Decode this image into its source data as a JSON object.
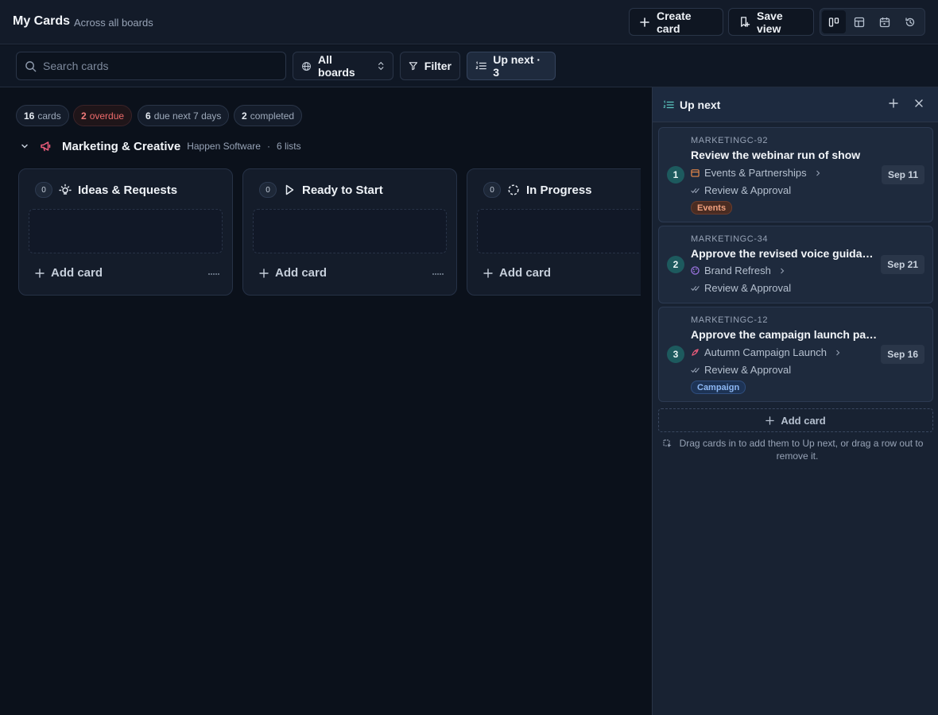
{
  "header": {
    "title": "My Cards",
    "subtitle": "Across all boards",
    "create_label": "Create card",
    "save_label": "Save view",
    "views": [
      "board-view-icon",
      "table-view-icon",
      "calendar-view-icon",
      "history-view-icon"
    ]
  },
  "toolbar": {
    "search_placeholder": "Search cards",
    "boards_label": "All boards",
    "filter_label": "Filter",
    "upnext_label": "Up next · 3"
  },
  "stats": [
    {
      "value": "16",
      "label": "cards"
    },
    {
      "value": "2",
      "label": "overdue"
    },
    {
      "value": "6",
      "label": "due next 7 days"
    },
    {
      "value": "2",
      "label": "completed"
    }
  ],
  "board": {
    "name": "Marketing & Creative",
    "workspace": "Happen Software",
    "separator": "·",
    "lists_count": "6 lists",
    "lists": [
      {
        "count": "0",
        "title": "Ideas & Requests",
        "icon": "lightbulb-icon",
        "add_label": "Add card"
      },
      {
        "count": "0",
        "title": "Ready to Start",
        "icon": "play-icon",
        "add_label": "Add card"
      },
      {
        "count": "0",
        "title": "In Progress",
        "icon": "progress-circle-icon",
        "add_label": "Add card"
      }
    ]
  },
  "panel": {
    "title": "Up next",
    "add_label": "Add card",
    "hint": "Drag cards in to add them to Up next, or drag a row out to remove it.",
    "cards": [
      {
        "rank": "1",
        "key": "MARKETINGC-92",
        "title": "Review the webinar run of show",
        "board": "Events & Partnerships",
        "list": "Review & Approval",
        "due": "Sep 11",
        "tag": "Events",
        "tag_color": "#f0a07e"
      },
      {
        "rank": "2",
        "key": "MARKETINGC-34",
        "title": "Approve the revised voice guidance",
        "board": "Brand Refresh",
        "list": "Review & Approval",
        "due": "Sep 21",
        "tag": ""
      },
      {
        "rank": "3",
        "key": "MARKETINGC-12",
        "title": "Approve the campaign launch pack...",
        "board": "Autumn Campaign Launch",
        "list": "Review & Approval",
        "due": "Sep 16",
        "tag": "Campaign",
        "tag_color": "#8db8f4"
      }
    ]
  },
  "colors": {
    "background": "#0b111b",
    "accent_teal": "#1d5a5e",
    "overdue": "#ef6b6b",
    "events_icon": "#e8894a",
    "brand_icon": "#a77bf0",
    "campaign_icon": "#ef5d7c"
  }
}
